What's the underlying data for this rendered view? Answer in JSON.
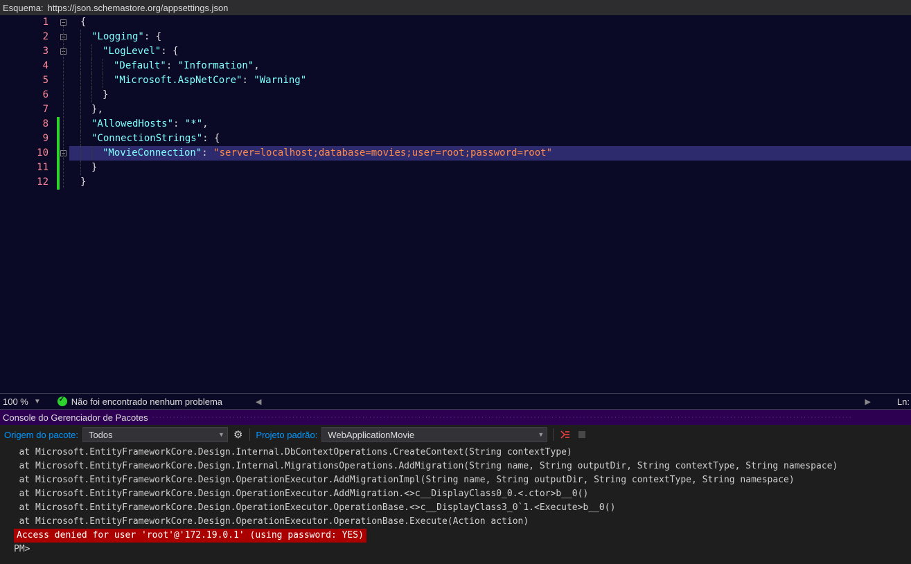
{
  "schema_bar": {
    "label": "Esquema:",
    "url": "https://json.schemastore.org/appsettings.json"
  },
  "editor": {
    "line_numbers": [
      "1",
      "2",
      "3",
      "4",
      "5",
      "6",
      "7",
      "8",
      "9",
      "10",
      "11",
      "12"
    ],
    "highlighted_line_index": 9,
    "change_marks": {
      "start_index": 7,
      "end_index": 11
    },
    "code": {
      "l1": {
        "brace": "{"
      },
      "l2": {
        "key": "\"Logging\"",
        "colon": ": ",
        "brace": "{"
      },
      "l3": {
        "key": "\"LogLevel\"",
        "colon": ": ",
        "brace": "{"
      },
      "l4": {
        "key": "\"Default\"",
        "colon": ": ",
        "val": "\"Information\"",
        "comma": ","
      },
      "l5": {
        "key": "\"Microsoft.AspNetCore\"",
        "colon": ": ",
        "val": "\"Warning\""
      },
      "l6": {
        "brace": "}"
      },
      "l7": {
        "brace": "}",
        "comma": ","
      },
      "l8": {
        "key": "\"AllowedHosts\"",
        "colon": ": ",
        "val": "\"*\"",
        "comma": ","
      },
      "l9": {
        "key": "\"ConnectionStrings\"",
        "colon": ": ",
        "brace": "{"
      },
      "l10": {
        "key": "\"MovieConnection\"",
        "colon": ": ",
        "val": "\"server=localhost;database=movies;user=root;password=root\""
      },
      "l11": {
        "brace": "}"
      },
      "l12": {
        "brace": "}"
      }
    }
  },
  "status": {
    "zoom": "100 %",
    "message": "Não foi encontrado nenhum problema",
    "ln_label": "Ln:"
  },
  "panel": {
    "title": "Console do Gerenciador de Pacotes",
    "source_label": "Origem do pacote:",
    "source_value": "Todos",
    "gear_title": "Configurações",
    "project_label": "Projeto padrão:",
    "project_value": "WebApplicationMovie"
  },
  "console": {
    "lines": [
      "   at Microsoft.EntityFrameworkCore.Design.Internal.DbContextOperations.CreateContext(String contextType)",
      "   at Microsoft.EntityFrameworkCore.Design.Internal.MigrationsOperations.AddMigration(String name, String outputDir, String contextType, String namespace)",
      "   at Microsoft.EntityFrameworkCore.Design.OperationExecutor.AddMigrationImpl(String name, String outputDir, String contextType, String namespace)",
      "   at Microsoft.EntityFrameworkCore.Design.OperationExecutor.AddMigration.<>c__DisplayClass0_0.<.ctor>b__0()",
      "   at Microsoft.EntityFrameworkCore.Design.OperationExecutor.OperationBase.<>c__DisplayClass3_0`1.<Execute>b__0()",
      "   at Microsoft.EntityFrameworkCore.Design.OperationExecutor.OperationBase.Execute(Action action)"
    ],
    "error": "Access denied for user 'root'@'172.19.0.1' (using password: YES)",
    "prompt": "PM>"
  }
}
